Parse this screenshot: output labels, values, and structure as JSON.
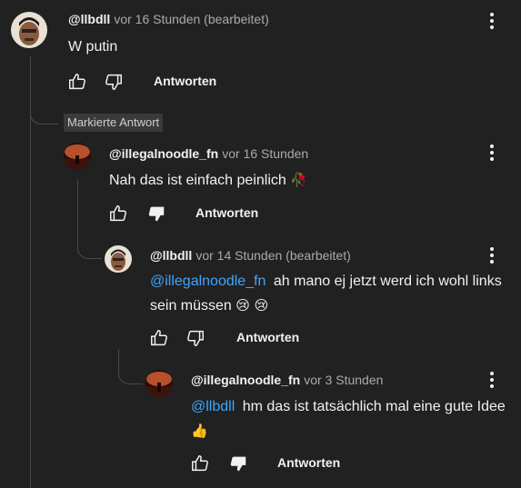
{
  "badge": "Markierte Antwort",
  "comments": [
    {
      "author": "@llbdll",
      "time": "vor 16 Stunden (bearbeitet)",
      "mention": "",
      "text": "W putin",
      "emoji": "",
      "reply": "Antworten"
    },
    {
      "author": "@illegalnoodle_fn",
      "time": "vor 16 Stunden",
      "mention": "",
      "text": "Nah das ist einfach peinlich",
      "emoji": "🥀",
      "reply": "Antworten"
    },
    {
      "author": "@llbdll",
      "time": "vor 14 Stunden (bearbeitet)",
      "mention": "@illegalnoodle_fn",
      "text": "ah mano ej jetzt werd ich wohl links sein müssen",
      "emoji": "😢 😢",
      "reply": "Antworten"
    },
    {
      "author": "@illegalnoodle_fn",
      "time": "vor 3 Stunden",
      "mention": "@llbdll",
      "text": "hm das ist tatsächlich mal eine gute Idee",
      "emoji": "👍",
      "reply": "Antworten"
    }
  ],
  "icons": {
    "like": "thumbs-up-icon",
    "dislike": "thumbs-down-icon",
    "dislike_filled": "thumbs-down-filled-icon",
    "menu": "more-vert-icon"
  },
  "colors": {
    "background": "#212121",
    "mention": "#3ea6ff",
    "muted": "#aaaaaa"
  }
}
